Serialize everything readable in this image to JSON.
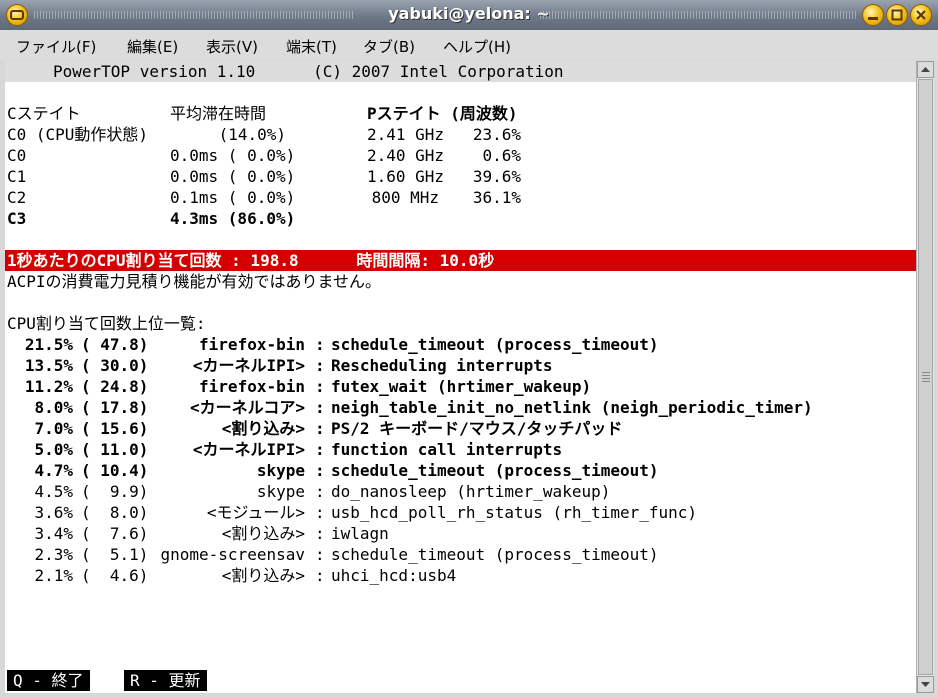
{
  "window": {
    "title": "yabuki@yelona: ~",
    "menu": [
      "ファイル(F)",
      "編集(E)",
      "表示(V)",
      "端末(T)",
      "タブ(B)",
      "ヘルプ(H)"
    ]
  },
  "terminal": {
    "header": "PowerTOP version 1.10      (C) 2007 Intel Corporation",
    "cstate_header": {
      "c": "Cステイト",
      "avg": "平均滞在時間",
      "p": "Pステイト (周波数)"
    },
    "cstates": [
      {
        "name": "C0 (CPU動作状態)",
        "avg": "(14.0%)",
        "freq": "2.41 GHz",
        "pct": "23.6%",
        "bold": false
      },
      {
        "name": "C0",
        "avg": "0.0ms ( 0.0%)",
        "freq": "2.40 GHz",
        "pct": "0.6%",
        "bold": false
      },
      {
        "name": "C1",
        "avg": "0.0ms ( 0.0%)",
        "freq": "1.60 GHz",
        "pct": "39.6%",
        "bold": false
      },
      {
        "name": "C2",
        "avg": "0.1ms ( 0.0%)",
        "freq": "800 MHz",
        "pct": "36.1%",
        "bold": false
      },
      {
        "name": "C3",
        "avg": "4.3ms (86.0%)",
        "freq": "",
        "pct": "",
        "bold": true
      }
    ],
    "wakeups_line": "1秒あたりのCPU割り当て回数 : 198.8      時間間隔: 10.0秒",
    "acpi_line": "ACPIの消費電力見積り機能が有効ではありません。",
    "top_title": "CPU割り当て回数上位一覧:",
    "top": [
      {
        "pct": "21.5%",
        "count": "( 47.8)",
        "proc": "firefox-bin",
        "func": "schedule_timeout (process_timeout)",
        "bold": true
      },
      {
        "pct": "13.5%",
        "count": "( 30.0)",
        "proc": "<カーネルIPI>",
        "func": "Rescheduling interrupts",
        "bold": true
      },
      {
        "pct": "11.2%",
        "count": "( 24.8)",
        "proc": "firefox-bin",
        "func": "futex_wait (hrtimer_wakeup)",
        "bold": true
      },
      {
        "pct": "8.0%",
        "count": "( 17.8)",
        "proc": "<カーネルコア>",
        "func": "neigh_table_init_no_netlink (neigh_periodic_timer)",
        "bold": true
      },
      {
        "pct": "7.0%",
        "count": "( 15.6)",
        "proc": "<割り込み>",
        "func": "PS/2 キーボード/マウス/タッチパッド",
        "bold": true
      },
      {
        "pct": "5.0%",
        "count": "( 11.0)",
        "proc": "<カーネルIPI>",
        "func": "function call interrupts",
        "bold": true
      },
      {
        "pct": "4.7%",
        "count": "( 10.4)",
        "proc": "skype",
        "func": "schedule_timeout (process_timeout)",
        "bold": true
      },
      {
        "pct": "4.5%",
        "count": "(  9.9)",
        "proc": "skype",
        "func": "do_nanosleep (hrtimer_wakeup)",
        "bold": false
      },
      {
        "pct": "3.6%",
        "count": "(  8.0)",
        "proc": "<モジュール>",
        "func": "usb_hcd_poll_rh_status (rh_timer_func)",
        "bold": false
      },
      {
        "pct": "3.4%",
        "count": "(  7.6)",
        "proc": "<割り込み>",
        "func": "iwlagn",
        "bold": false
      },
      {
        "pct": "2.3%",
        "count": "(  5.1)",
        "proc": "gnome-screensav",
        "func": "schedule_timeout (process_timeout)",
        "bold": false
      },
      {
        "pct": "2.1%",
        "count": "(  4.6)",
        "proc": "<割り込み>",
        "func": "uhci_hcd:usb4",
        "bold": false
      }
    ],
    "keys": [
      "Q - 終了",
      "R - 更新"
    ]
  }
}
